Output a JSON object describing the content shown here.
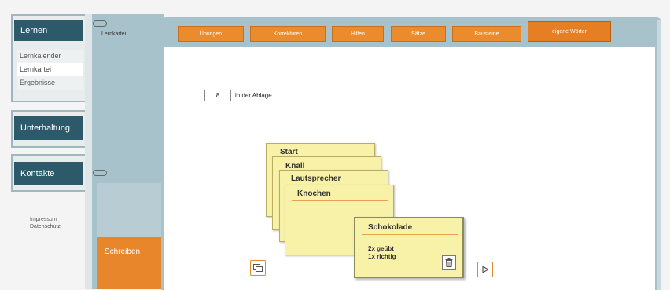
{
  "sidebar": {
    "sections": [
      {
        "title": "Lernen",
        "items": [
          "Lernkalender",
          "Lernkartei",
          "Ergebnisse"
        ]
      },
      {
        "title": "Unterhaltung"
      },
      {
        "title": "Kontakte"
      }
    ],
    "footer_links": [
      "Impressum",
      "Datenschutz"
    ]
  },
  "side_panel": {
    "top_label": "Lernkartei",
    "bottom_label": "Schreiben"
  },
  "tabs": [
    "Übungen",
    "Korrekturen",
    "Hilfen",
    "Sätze",
    "Bausteine",
    "eigene Wörter"
  ],
  "active_tab_index": 5,
  "main": {
    "counter_value": "8",
    "counter_label": "in der Ablage",
    "stack_cards": [
      "Start",
      "Knall",
      "Lautsprecher",
      "Knochen"
    ],
    "focus_card": {
      "title": "Schokolade",
      "stat_practiced": "2x geübt",
      "stat_correct": "1x richtig"
    }
  },
  "colors": {
    "nav_header": "#2d5a6b",
    "accent_orange": "#e8862b",
    "panel_blue": "#a8c2cc",
    "card_yellow": "#f8f1a8"
  }
}
